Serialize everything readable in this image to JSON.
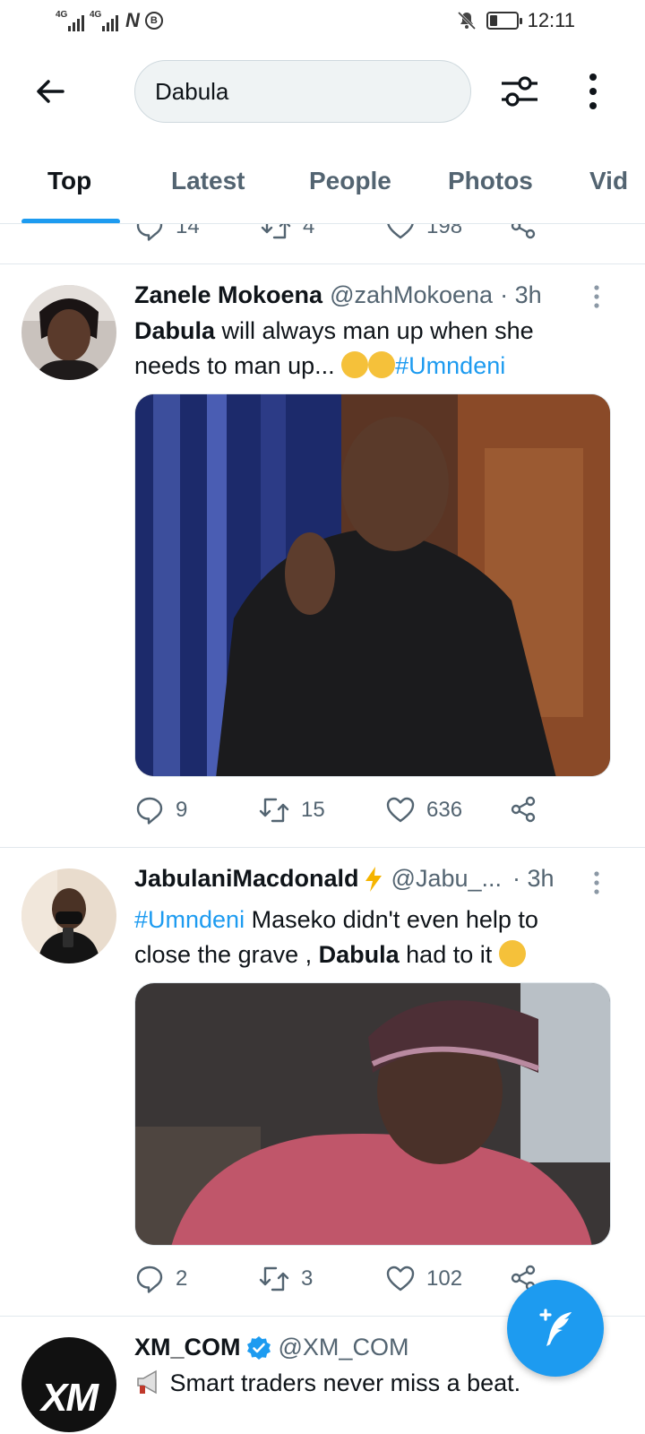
{
  "status_bar": {
    "network_1": "4G",
    "network_2": "4G",
    "time": "12:11"
  },
  "header": {
    "search_value": "Dabula"
  },
  "tabs": [
    {
      "label": "Top",
      "active": true
    },
    {
      "label": "Latest",
      "active": false
    },
    {
      "label": "People",
      "active": false
    },
    {
      "label": "Photos",
      "active": false
    },
    {
      "label": "Vid",
      "active": false
    }
  ],
  "prev_tweet": {
    "replies": "14",
    "retweets": "4",
    "likes": "198"
  },
  "tweets": [
    {
      "name": "Zanele Mokoena",
      "handle": "@zahMokoena",
      "time": "· 3h",
      "text_bold": "Dabula",
      "text_rest": " will always man up when she needs to man up... ",
      "hashtag": "#Umndeni",
      "replies": "9",
      "retweets": "15",
      "likes": "636"
    },
    {
      "name": "JabulaniMacdonald",
      "handle": "@Jabu_...",
      "time": "· 3h",
      "hashtag": "#Umndeni",
      "text_part1": " Maseko didn't even help to close the grave , ",
      "text_bold": "Dabula",
      "text_part2": " had to it ",
      "replies": "2",
      "retweets": "3",
      "likes": "102"
    },
    {
      "name": "XM_COM",
      "handle": "@XM_COM",
      "avatar_text": "XM",
      "text": "Smart traders never miss a beat."
    }
  ],
  "colors": {
    "accent": "#1d9bf0",
    "secondary_text": "#536471",
    "primary_text": "#0f1419"
  }
}
